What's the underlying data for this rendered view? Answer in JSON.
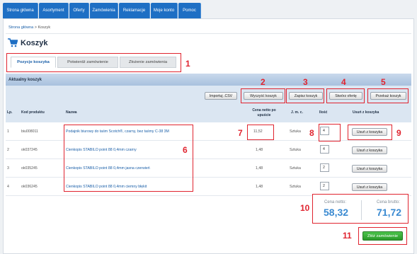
{
  "nav": {
    "items": [
      "Strona główna",
      "Asortyment",
      "Oferty",
      "Zamówienia",
      "Reklamacje",
      "Moje konto",
      "Pomoc"
    ]
  },
  "breadcrumb": {
    "home": "Strona główna",
    "sep": ">",
    "current": "Koszyk"
  },
  "page": {
    "title": "Koszyk"
  },
  "tabs": [
    "Pozycje koszyka",
    "Potwierdź zamówienie",
    "Złożenie zamówienia"
  ],
  "section": {
    "title": "Aktualny koszyk"
  },
  "toolbar": {
    "import": "Importuj .CSV",
    "clear": "Wyczyść koszyk",
    "save": "Zapisz koszyk",
    "offer": "Stwórz ofertę",
    "pass": "Przekaż koszyk"
  },
  "table": {
    "headers": {
      "lp": "Lp.",
      "code": "Kod produktu",
      "name": "Nazwa",
      "price": "Cena netto po upuście",
      "unit": "J. m. c.",
      "qty": "Ilość",
      "remove": "Usuń z koszyka"
    },
    "rows": [
      {
        "lp": "1",
        "code": "biu008011",
        "name": "Podajnik biurowy do taśm Scotch®, czarny, bez taśmy C-38 3M",
        "price": "11,52",
        "unit": "Sztuka",
        "qty": "4",
        "remove": "Usuń z koszyka"
      },
      {
        "lp": "2",
        "code": "ok037245",
        "name": "Cienkopis STABILO point 88 0,4mm czarny",
        "price": "1,48",
        "unit": "Sztuka",
        "qty": "4",
        "remove": "Usuń z koszyka"
      },
      {
        "lp": "3",
        "code": "ok035245",
        "name": "Cienkopis STABILO point 88 0,4mm jasna czerwień",
        "price": "1,48",
        "unit": "Sztuka",
        "qty": "2",
        "remove": "Usuń z koszyka"
      },
      {
        "lp": "4",
        "code": "ok036245",
        "name": "Cienkopis STABILO point 88 0,4mm ciemny błękit",
        "price": "1,48",
        "unit": "Sztuka",
        "qty": "2",
        "remove": "Usuń z koszyka"
      }
    ]
  },
  "totals": {
    "net_label": "Cena netto:",
    "net_value": "58,32",
    "gross_label": "Cena brutto:",
    "gross_value": "71,72"
  },
  "order_button": "Złóż zamówienie",
  "annotations": [
    "1",
    "2",
    "3",
    "4",
    "5",
    "6",
    "7",
    "8",
    "9",
    "10",
    "11"
  ],
  "colors": {
    "brand": "#1e6fc4",
    "highlight": "#e0242f",
    "order": "#2fa62f",
    "total": "#3a8ad1"
  }
}
